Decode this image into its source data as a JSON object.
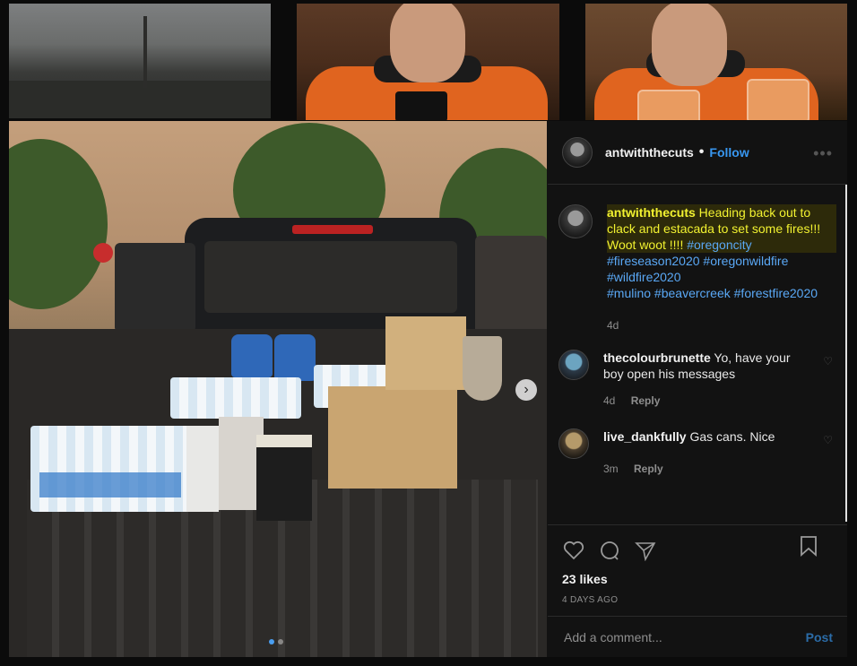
{
  "background": {
    "tiles": [
      "smoke-field",
      "man-orange-shirt-phone",
      "man-orange-shirt-drink"
    ]
  },
  "post": {
    "author": {
      "username": "antwiththecuts",
      "separator": "•",
      "follow_label": "Follow"
    },
    "photo": {
      "subject": "truck-bed-supplies",
      "next_icon": "›"
    },
    "caption": {
      "username": "antwiththecuts",
      "text": "Heading back out to clack and estacada to set some fires!!! Woot woot !!!! ",
      "tags": [
        "#oregoncity",
        "#fireseason2020",
        "#oregonwildfire",
        "#wildfire2020",
        "#mulino",
        "#beavercreek",
        "#forestfire2020"
      ],
      "time": "4d"
    },
    "comments": [
      {
        "username": "thecolourbrunette",
        "text": "Yo, have your boy open his messages",
        "time": "4d",
        "reply_label": "Reply"
      },
      {
        "username": "live_dankfully",
        "text": "Gas cans. Nice",
        "time": "3m",
        "reply_label": "Reply"
      }
    ],
    "likes": "23 likes",
    "posted": "4 DAYS AGO",
    "add_comment_placeholder": "Add a comment...",
    "post_button": "Post"
  },
  "colors": {
    "link": "#3897f0",
    "highlight": "#f2f230",
    "hashtag": "#5aa8f5"
  }
}
